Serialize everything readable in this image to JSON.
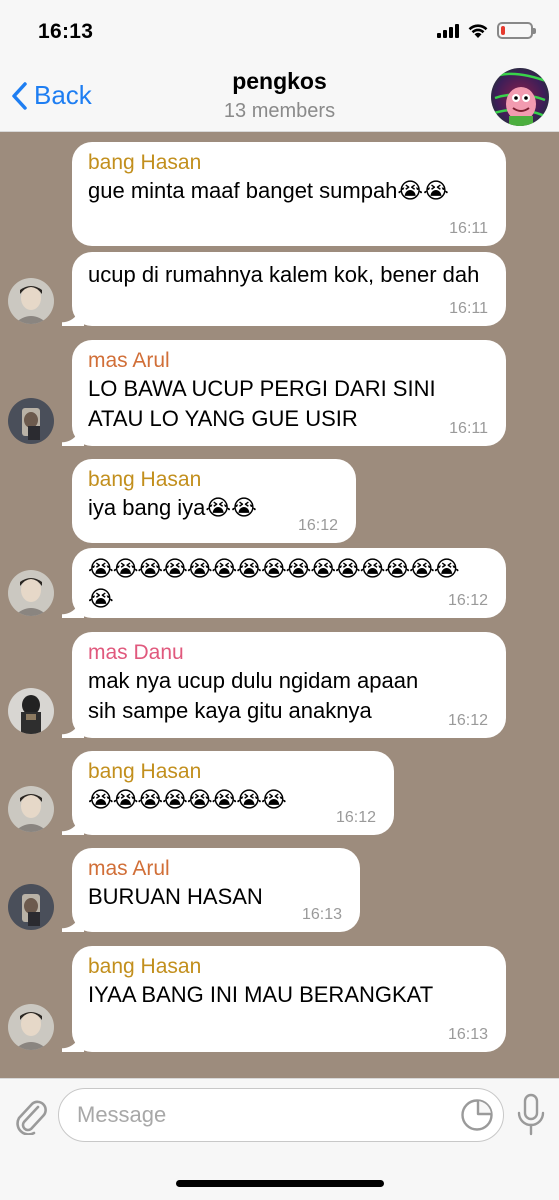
{
  "status": {
    "time": "16:13",
    "battery_level": 0.15,
    "battery_color": "#e53a2e"
  },
  "nav": {
    "back_label": "Back",
    "title": "pengkos",
    "subtitle": "13 members"
  },
  "colors": {
    "accent": "#1e7ef2",
    "chat_background": "#9d8c7d",
    "sender_hasan": "#c28f1d",
    "sender_arul": "#d16f38",
    "sender_danu": "#e0597d"
  },
  "messages": [
    {
      "sender": "bang Hasan",
      "text": "gue minta maaf banget sumpah😭😭",
      "time": "16:11"
    },
    {
      "sender": "",
      "text": "ucup di rumahnya kalem kok, bener dah",
      "time": "16:11"
    },
    {
      "sender": "mas Arul",
      "text": "LO BAWA UCUP PERGI DARI SINI ATAU LO YANG GUE USIR",
      "time": "16:11"
    },
    {
      "sender": "bang Hasan",
      "text": "iya bang iya😭😭",
      "time": "16:12"
    },
    {
      "sender": "",
      "text": "😭😭😭😭😭😭😭😭😭😭😭😭😭😭😭😭",
      "time": "16:12"
    },
    {
      "sender": "mas Danu",
      "text": "mak nya ucup dulu ngidam apaan sih sampe kaya gitu anaknya",
      "time": "16:12"
    },
    {
      "sender": "bang Hasan",
      "text": "😭😭😭😭😭😭😭😭",
      "time": "16:12"
    },
    {
      "sender": "mas Arul",
      "text": "BURUAN HASAN",
      "time": "16:13"
    },
    {
      "sender": "bang Hasan",
      "text": "IYAA BANG INI MAU BERANGKAT",
      "time": "16:13"
    }
  ],
  "composer": {
    "placeholder": "Message",
    "attach_icon": "paperclip-icon",
    "sticker_icon": "sticker-icon",
    "mic_icon": "microphone-icon"
  }
}
